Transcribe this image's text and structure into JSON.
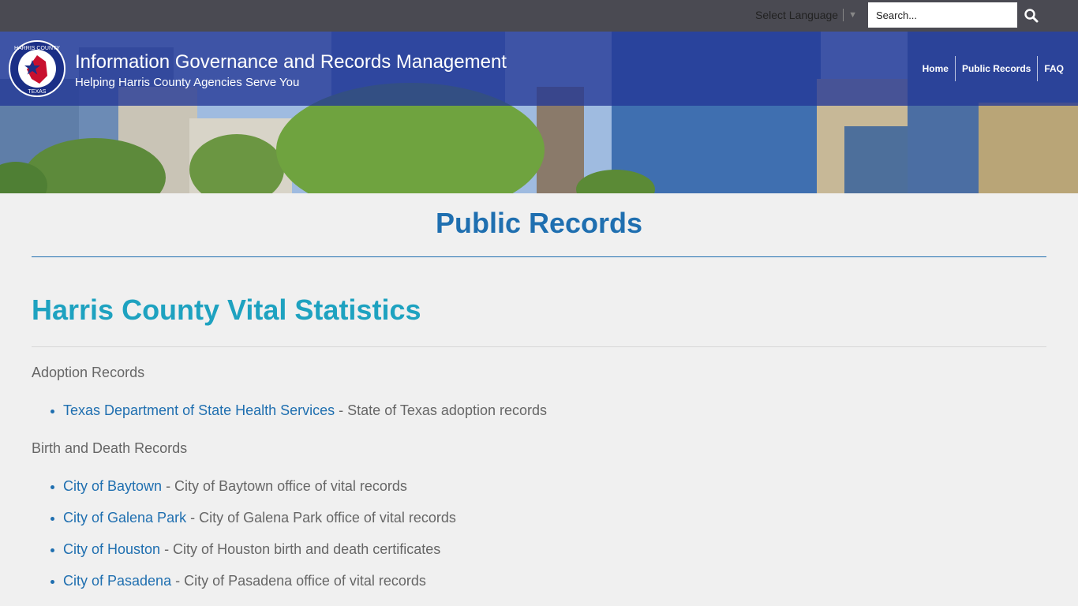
{
  "topbar": {
    "language_label": "Select Language",
    "language_caret": "▼",
    "search_placeholder": "Search..."
  },
  "header": {
    "logo_text_top": "HARRIS COUNTY",
    "logo_text_bottom": "TEXAS",
    "title": "Information Governance and Records Management",
    "subtitle": "Helping Harris County Agencies Serve You",
    "nav": [
      "Home",
      "Public Records",
      "FAQ"
    ]
  },
  "main": {
    "page_title": "Public Records",
    "section_title": "Harris County Vital Statistics",
    "groups": [
      {
        "label": "Adoption Records",
        "items": [
          {
            "link": "Texas Department of State Health Services",
            "desc": " - State of Texas adoption records"
          }
        ]
      },
      {
        "label": "Birth and Death Records",
        "items": [
          {
            "link": "City of Baytown",
            "desc": " - City of Baytown office of vital records"
          },
          {
            "link": "City of Galena Park",
            "desc": " - City of Galena Park office of vital records"
          },
          {
            "link": "City of Houston",
            "desc": " - City of Houston birth and death certificates"
          },
          {
            "link": "City of Pasadena",
            "desc": " - City of Pasadena office of vital records"
          }
        ]
      }
    ]
  },
  "colors": {
    "topbar": "#4a4a52",
    "band": "#23379a",
    "link": "#1f6fb0",
    "section_title": "#1ea2c0"
  }
}
